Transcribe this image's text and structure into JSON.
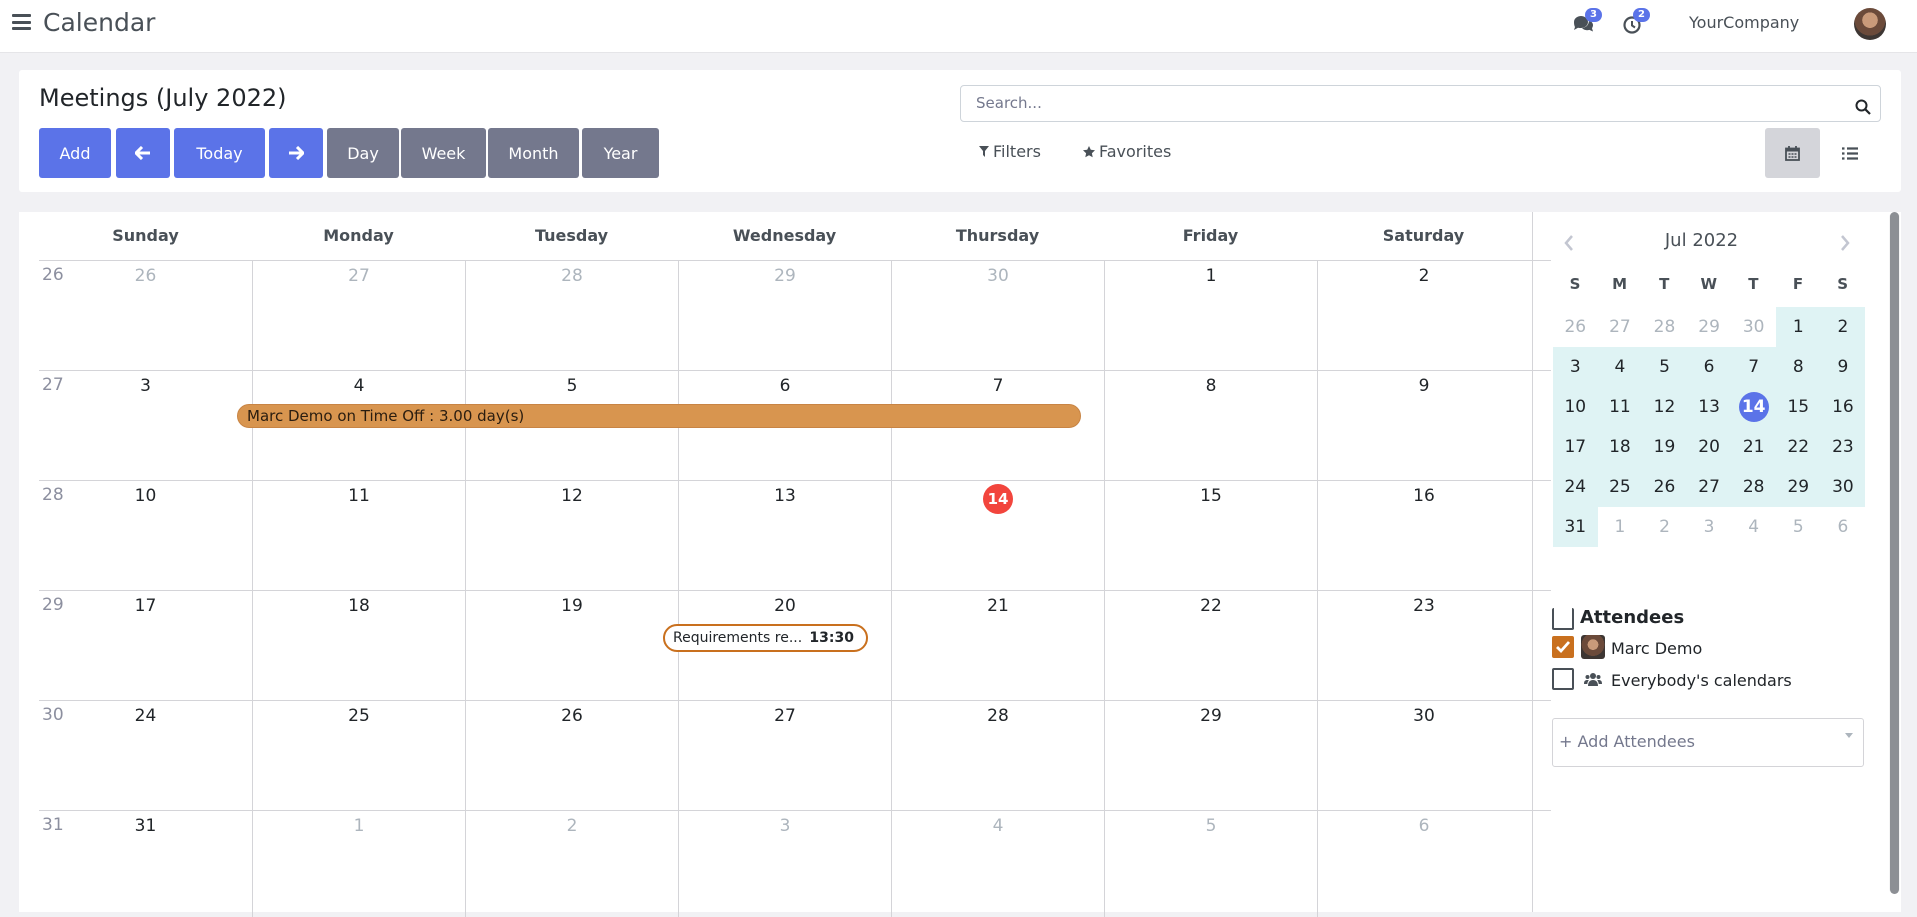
{
  "topbar": {
    "app_title": "Calendar",
    "messages_count": "3",
    "activities_count": "2",
    "company": "YourCompany"
  },
  "control_panel": {
    "title": "Meetings (July 2022)",
    "buttons": {
      "add": "Add",
      "prev": "←",
      "today": "Today",
      "next": "→"
    },
    "scales": [
      "Day",
      "Week",
      "Month",
      "Year"
    ],
    "search_placeholder": "Search...",
    "filters_label": "Filters",
    "favorites_label": "Favorites",
    "active_view": "calendar"
  },
  "calendar": {
    "weekdays": [
      "Sunday",
      "Monday",
      "Tuesday",
      "Wednesday",
      "Thursday",
      "Friday",
      "Saturday"
    ],
    "weeks": [
      {
        "num": "26",
        "days": [
          "26",
          "27",
          "28",
          "29",
          "30",
          "1",
          "2"
        ],
        "muted": [
          true,
          true,
          true,
          true,
          true,
          false,
          false
        ]
      },
      {
        "num": "27",
        "days": [
          "3",
          "4",
          "5",
          "6",
          "7",
          "8",
          "9"
        ],
        "muted": [
          false,
          false,
          false,
          false,
          false,
          false,
          false
        ]
      },
      {
        "num": "28",
        "days": [
          "10",
          "11",
          "12",
          "13",
          "14",
          "15",
          "16"
        ],
        "muted": [
          false,
          false,
          false,
          false,
          false,
          false,
          false
        ]
      },
      {
        "num": "29",
        "days": [
          "17",
          "18",
          "19",
          "20",
          "21",
          "22",
          "23"
        ],
        "muted": [
          false,
          false,
          false,
          false,
          false,
          false,
          false
        ]
      },
      {
        "num": "30",
        "days": [
          "24",
          "25",
          "26",
          "27",
          "28",
          "29",
          "30"
        ],
        "muted": [
          false,
          false,
          false,
          false,
          false,
          false,
          false
        ]
      },
      {
        "num": "31",
        "days": [
          "31",
          "1",
          "2",
          "3",
          "4",
          "5",
          "6"
        ],
        "muted": [
          false,
          true,
          true,
          true,
          true,
          true,
          true
        ]
      }
    ],
    "today": "14",
    "events": {
      "timeoff": {
        "title": "Marc Demo on Time Off : 3.00 day(s)",
        "color": "#d8954f"
      },
      "meeting": {
        "title": "Requirements re...",
        "time": "13:30",
        "color": "#c9701e"
      }
    }
  },
  "mini_calendar": {
    "title": "Jul 2022",
    "prev": "‹",
    "next": "›",
    "weekdays": [
      "S",
      "M",
      "T",
      "W",
      "T",
      "F",
      "S"
    ],
    "weeks": [
      [
        "26",
        "27",
        "28",
        "29",
        "30",
        "1",
        "2"
      ],
      [
        "3",
        "4",
        "5",
        "6",
        "7",
        "8",
        "9"
      ],
      [
        "10",
        "11",
        "12",
        "13",
        "14",
        "15",
        "16"
      ],
      [
        "17",
        "18",
        "19",
        "20",
        "21",
        "22",
        "23"
      ],
      [
        "24",
        "25",
        "26",
        "27",
        "28",
        "29",
        "30"
      ],
      [
        "31",
        "1",
        "2",
        "3",
        "4",
        "5",
        "6"
      ]
    ],
    "today": "14"
  },
  "attendees": {
    "title": "Attendees",
    "items": [
      {
        "label": "Marc Demo",
        "checked": true
      },
      {
        "label": "Everybody's calendars",
        "checked": false
      }
    ],
    "add_placeholder": "+ Add Attendees"
  },
  "colors": {
    "primary": "#5b73e8",
    "secondary": "#74788d",
    "today": "#f2453d",
    "event": "#d8954f"
  }
}
